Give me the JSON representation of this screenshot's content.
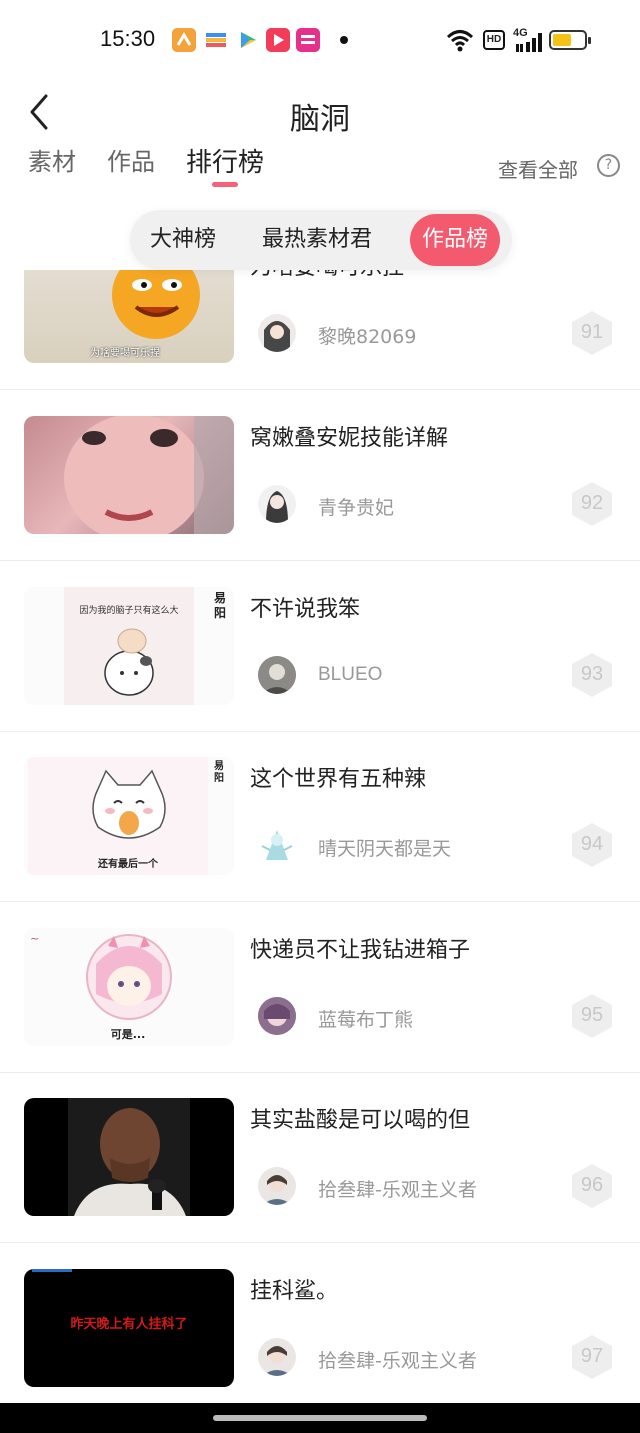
{
  "status_bar": {
    "time": "15:30",
    "network": "4G",
    "hd": "HD",
    "app_icons": [
      "orange-app-icon",
      "wallet-app-icon",
      "play-store-icon",
      "video-app-icon",
      "pink-app-icon"
    ]
  },
  "header": {
    "title": "脑洞",
    "back_icon": "back-arrow-icon"
  },
  "tabs": {
    "items": [
      "素材",
      "作品",
      "排行榜"
    ],
    "active": "排行榜",
    "view_all": "查看全部",
    "help_icon": "?"
  },
  "segment": {
    "items": [
      "大神榜",
      "最热素材君",
      "作品榜"
    ],
    "active": "作品榜"
  },
  "rankings": [
    {
      "rank": "91",
      "title": "为啥要喝可乐捏",
      "author": "黎晚82069",
      "thumb_caption": "为啥要喝可乐捏"
    },
    {
      "rank": "92",
      "title": "窝嫩叠安妮技能详解",
      "author": "青争贵妃"
    },
    {
      "rank": "93",
      "title": "不许说我笨",
      "author": "BLUEO",
      "thumb_caption": "因为我的脑子只有这么大",
      "thumb_side": "易阳"
    },
    {
      "rank": "94",
      "title": "这个世界有五种辣",
      "author": "晴天阴天都是天",
      "thumb_caption": "还有最后一个",
      "thumb_side": "易阳"
    },
    {
      "rank": "95",
      "title": "快递员不让我钻进箱子",
      "author": "蓝莓布丁熊",
      "thumb_caption": "可是..."
    },
    {
      "rank": "96",
      "title": "其实盐酸是可以喝的但",
      "author": "拾叁肆-乐观主义者"
    },
    {
      "rank": "97",
      "title": "挂科鲨。",
      "author": "拾叁肆-乐观主义者",
      "thumb_caption": "昨天晚上有人挂科了"
    }
  ],
  "colors": {
    "accent": "#f45a6e",
    "tab_underline": "#f5627a",
    "rank_badge": "#eeeeee",
    "muted_text": "#999999"
  }
}
